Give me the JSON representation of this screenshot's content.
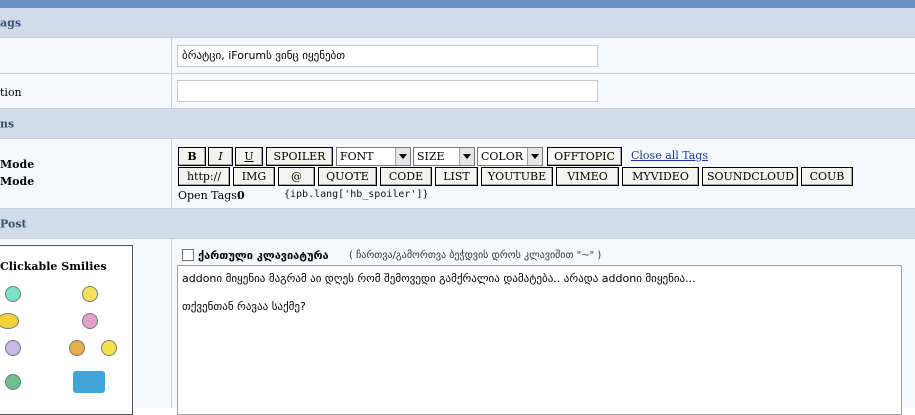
{
  "sections": {
    "tags": "ags",
    "options": "ns",
    "post": "Post"
  },
  "fields": {
    "tags_label": "",
    "tags_value": "ბრატცი, iForumს ვინც იყენებთ",
    "description_label": "tion",
    "description_value": ""
  },
  "modes": {
    "line1": "Mode",
    "line2": "Mode"
  },
  "toolbar": {
    "bold": "B",
    "italic": "I",
    "underline": "U",
    "spoiler": "SPOILER",
    "font": "FONT",
    "size": "SIZE",
    "color": "COLOR",
    "offtopic": "OFFTOPIC",
    "close_all": "Close all Tags",
    "http": "http://",
    "img": "IMG",
    "at": "@",
    "quote": "QUOTE",
    "code": "CODE",
    "list": "LIST",
    "youtube": "YOUTUBE",
    "vimeo": "VIMEO",
    "myvideo": "MYVIDEO",
    "soundcloud": "SOUNDCLOUD",
    "coub": "COUB",
    "open_tags_label": "Open Tags:",
    "open_tags_count": "0",
    "spoiler_lang": "{ipb.lang['hb_spoiler']}"
  },
  "smilies": {
    "title": "Clickable Smilies"
  },
  "keyboard": {
    "label": "ქართული კლავიატურა",
    "hint": "( ჩართვა/გამორთვა ბეჭდვის დროს კლავიშით \"~\" )"
  },
  "editor": {
    "line1": "addonი მიყენია მაგრამ აი დღეს რომ შემოვედი გამქრალია დამატება.. არადა addonი მიყენია...",
    "line2": "თქვენთან რავაა საქმე?"
  },
  "colors": {
    "topbar": "#6b8fc4",
    "header": "#d1dceb",
    "row": "#f5f9fd",
    "link": "#1c3a9e"
  }
}
